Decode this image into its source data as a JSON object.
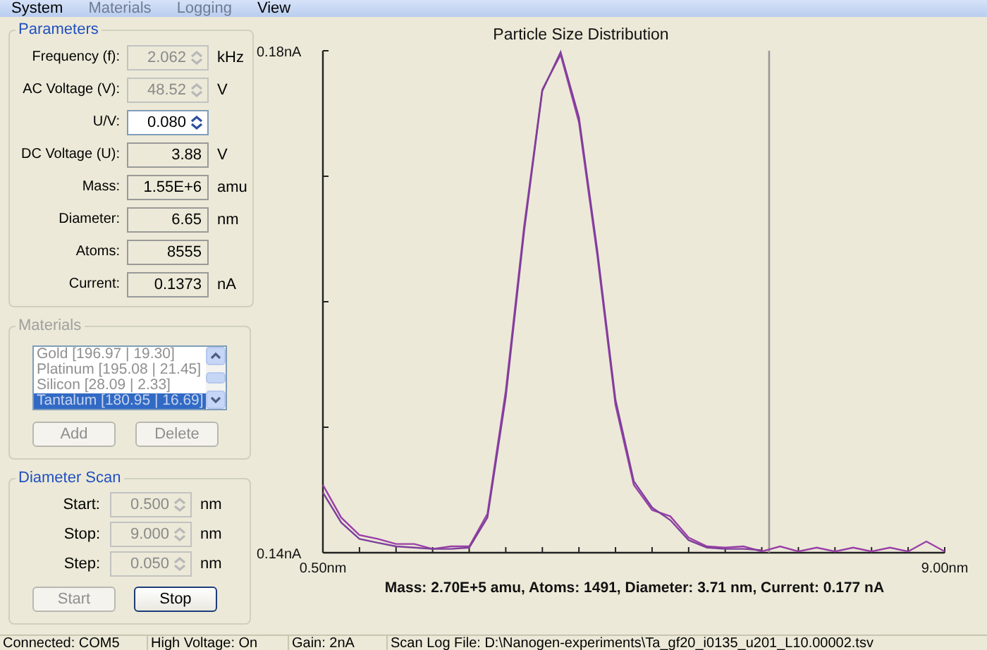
{
  "menu": [
    {
      "label": "System",
      "disabled": false
    },
    {
      "label": "Materials",
      "disabled": true
    },
    {
      "label": "Logging",
      "disabled": true
    },
    {
      "label": "View",
      "disabled": false
    }
  ],
  "parameters": {
    "title": "Parameters",
    "fields": [
      {
        "label": "Frequency (f):",
        "value": "2.062",
        "unit": "kHz",
        "kind": "spin",
        "disabled": true
      },
      {
        "label": "AC Voltage (V):",
        "value": "48.52",
        "unit": "V",
        "kind": "spin",
        "disabled": true
      },
      {
        "label": "U/V:",
        "value": "0.080",
        "kind": "spin",
        "disabled": false
      },
      {
        "label": "DC Voltage (U):",
        "value": "3.88",
        "unit": "V",
        "kind": "readout"
      },
      {
        "label": "Mass:",
        "value": "1.55E+6",
        "unit": "amu",
        "kind": "readout"
      },
      {
        "label": "Diameter:",
        "value": "6.65",
        "unit": "nm",
        "kind": "readout"
      },
      {
        "label": "Atoms:",
        "value": "8555",
        "kind": "readout"
      },
      {
        "label": "Current:",
        "value": "0.1373",
        "unit": "nA",
        "kind": "readout"
      }
    ]
  },
  "materials": {
    "title": "Materials",
    "disabled": true,
    "items": [
      {
        "label": "Gold [196.97 | 19.30]",
        "selected": false
      },
      {
        "label": "Platinum [195.08 | 21.45]",
        "selected": false
      },
      {
        "label": "Silicon [28.09 | 2.33]",
        "selected": false
      },
      {
        "label": "Tantalum [180.95 | 16.69]",
        "selected": true
      }
    ],
    "buttons": [
      {
        "label": "Add",
        "disabled": true
      },
      {
        "label": "Delete",
        "disabled": true
      }
    ]
  },
  "diameter_scan": {
    "title": "Diameter Scan",
    "fields": [
      {
        "label": "Start:",
        "value": "0.500",
        "unit": "nm",
        "disabled": true
      },
      {
        "label": "Stop:",
        "value": "9.000",
        "unit": "nm",
        "disabled": true
      },
      {
        "label": "Step:",
        "value": "0.050",
        "unit": "nm",
        "disabled": true
      }
    ],
    "buttons": [
      {
        "label": "Start",
        "disabled": true
      },
      {
        "label": "Stop",
        "disabled": false
      }
    ]
  },
  "chart": {
    "caption": "Mass: 2.70E+5 amu,  Atoms: 1491,  Diameter: 3.71 nm,  Current: 0.177 nA",
    "chart_data": {
      "type": "line",
      "title": "Particle Size Distribution",
      "x": [
        0.5,
        0.75,
        1.0,
        1.25,
        1.5,
        1.75,
        2.0,
        2.25,
        2.5,
        2.75,
        3.0,
        3.25,
        3.5,
        3.75,
        4.0,
        4.25,
        4.5,
        4.75,
        5.0,
        5.25,
        5.5,
        5.75,
        6.0,
        6.25,
        6.5,
        6.75,
        7.0,
        7.25,
        7.5,
        7.75,
        8.0,
        8.25,
        8.5,
        8.75,
        9.0
      ],
      "series": [
        {
          "color": "#9b3fa8",
          "values": [
            0.1454,
            0.1428,
            0.1414,
            0.1411,
            0.1407,
            0.1407,
            0.1403,
            0.1405,
            0.1405,
            0.1431,
            0.1529,
            0.166,
            0.1769,
            0.1797,
            0.1743,
            0.1637,
            0.1518,
            0.1454,
            0.1434,
            0.1429,
            0.1412,
            0.1405,
            0.1404,
            0.1405,
            0.1401,
            0.1405,
            0.1401,
            0.1404,
            0.1401,
            0.1404,
            0.1401,
            0.1404,
            0.1401,
            0.1409,
            0.1401
          ]
        },
        {
          "color": "#7d3f9a",
          "values": [
            0.1448,
            0.1424,
            0.1411,
            0.1408,
            0.1405,
            0.1404,
            0.1403,
            0.1403,
            0.1404,
            0.1428,
            0.1524,
            0.1656,
            0.1768,
            0.1799,
            0.1747,
            0.1641,
            0.1522,
            0.1457,
            0.1436,
            0.1426,
            0.141,
            0.1404,
            0.1403,
            0.1403,
            0.1402,
            null,
            null,
            null,
            null,
            null,
            null,
            null,
            null,
            null,
            null
          ]
        }
      ],
      "xlim": [
        0.5,
        9.0
      ],
      "ylim": [
        0.14,
        0.18
      ],
      "xticks": [
        {
          "value": 0.5,
          "label": "0.50nm"
        },
        {
          "value": 9.0,
          "label": "9.00nm"
        }
      ],
      "yticks": [
        {
          "value": 0.14,
          "label": "0.14nA"
        },
        {
          "value": 0.18,
          "label": "0.18nA"
        }
      ],
      "ref_lines": [
        {
          "axis": "x",
          "value": 6.6,
          "color": "#999999"
        }
      ]
    }
  },
  "status_bar": [
    "Connected: COM5",
    "High Voltage: On",
    "Gain: 2nA",
    "Scan Log File: D:\\Nanogen-experiments\\Ta_gf20_i0135_u201_L10.00002.tsv"
  ]
}
